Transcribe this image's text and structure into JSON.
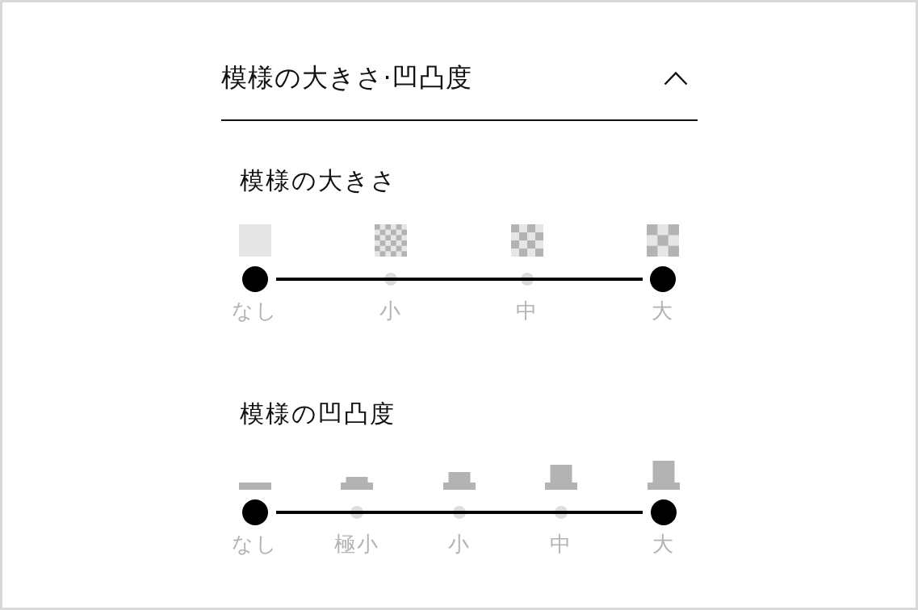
{
  "section": {
    "title": "模様の大きさ·凹凸度",
    "expanded": true,
    "sliders": [
      {
        "title": "模様の大きさ",
        "kind": "pattern",
        "stops": [
          {
            "label": "なし",
            "selected": true
          },
          {
            "label": "小",
            "selected": false
          },
          {
            "label": "中",
            "selected": false
          },
          {
            "label": "大",
            "selected": true
          }
        ]
      },
      {
        "title": "模様の凹凸度",
        "kind": "relief",
        "stops": [
          {
            "label": "なし",
            "selected": true
          },
          {
            "label": "極小",
            "selected": false
          },
          {
            "label": "小",
            "selected": false
          },
          {
            "label": "中",
            "selected": false
          },
          {
            "label": "大",
            "selected": true
          }
        ]
      }
    ]
  }
}
